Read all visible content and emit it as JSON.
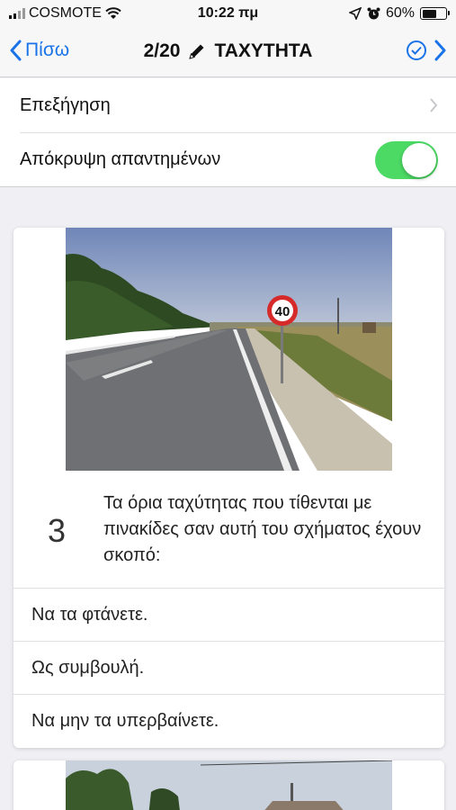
{
  "status_bar": {
    "carrier": "COSMOTE",
    "time": "10:22 πμ",
    "battery_percent": "60%",
    "battery_level": 0.6
  },
  "nav": {
    "back_label": "Πίσω",
    "progress": "2/20",
    "title": "ΤΑΧΥΤΗΤΑ",
    "icons": [
      "chevron-left-icon",
      "pencil-icon",
      "check-circle-icon",
      "chevron-right-icon"
    ]
  },
  "settings": {
    "explanation_label": "Επεξήγηση",
    "hide_answered_label": "Απόκρυψη απαντημένων",
    "hide_answered_on": true
  },
  "question": {
    "number": "3",
    "text": "Τα όρια ταχύτητας που τίθενται με πινακίδες σαν αυτή του σχήματος έχουν σκοπό:",
    "sign_value": "40",
    "answers": [
      "Να τα φτάνετε.",
      "Ως συμβουλή.",
      "Να μην τα υπερβαίνετε."
    ]
  },
  "colors": {
    "accent": "#1a73e8",
    "toggle_on": "#4cd964",
    "background": "#efeff4"
  }
}
